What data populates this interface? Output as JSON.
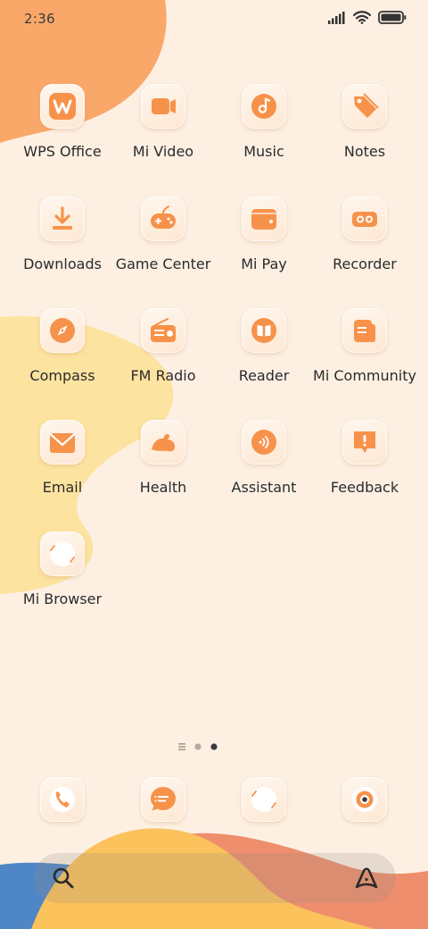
{
  "status_bar": {
    "time": "2:36",
    "icons": [
      "signal-icon",
      "wifi-icon",
      "battery-icon"
    ]
  },
  "apps": [
    {
      "label": "WPS Office",
      "icon": "wps-office-icon"
    },
    {
      "label": "Mi Video",
      "icon": "mi-video-icon"
    },
    {
      "label": "Music",
      "icon": "music-icon"
    },
    {
      "label": "Notes",
      "icon": "notes-icon"
    },
    {
      "label": "Downloads",
      "icon": "downloads-icon"
    },
    {
      "label": "Game Center",
      "icon": "game-center-icon"
    },
    {
      "label": "Mi Pay",
      "icon": "mi-pay-icon"
    },
    {
      "label": "Recorder",
      "icon": "recorder-icon"
    },
    {
      "label": "Compass",
      "icon": "compass-icon"
    },
    {
      "label": "FM Radio",
      "icon": "fm-radio-icon"
    },
    {
      "label": "Reader",
      "icon": "reader-icon"
    },
    {
      "label": "Mi Community",
      "icon": "mi-community-icon"
    },
    {
      "label": "Email",
      "icon": "email-icon"
    },
    {
      "label": "Health",
      "icon": "health-icon"
    },
    {
      "label": "Assistant",
      "icon": "assistant-icon"
    },
    {
      "label": "Feedback",
      "icon": "feedback-icon"
    },
    {
      "label": "Mi Browser",
      "icon": "mi-browser-icon"
    }
  ],
  "page_indicator": {
    "pages": 3,
    "current": 3
  },
  "dock": [
    {
      "icon": "phone-icon"
    },
    {
      "icon": "messages-icon"
    },
    {
      "icon": "browser-icon"
    },
    {
      "icon": "camera-icon"
    }
  ],
  "search_bar": {
    "icons": [
      "search-icon",
      "assistant-logo-icon"
    ]
  },
  "colors": {
    "background": "#fdf0e3",
    "accent": "#f7924a",
    "blob_orange": "#f9a86a",
    "blob_yellow": "#fde3a0",
    "blob_blue": "#4f86c6"
  }
}
